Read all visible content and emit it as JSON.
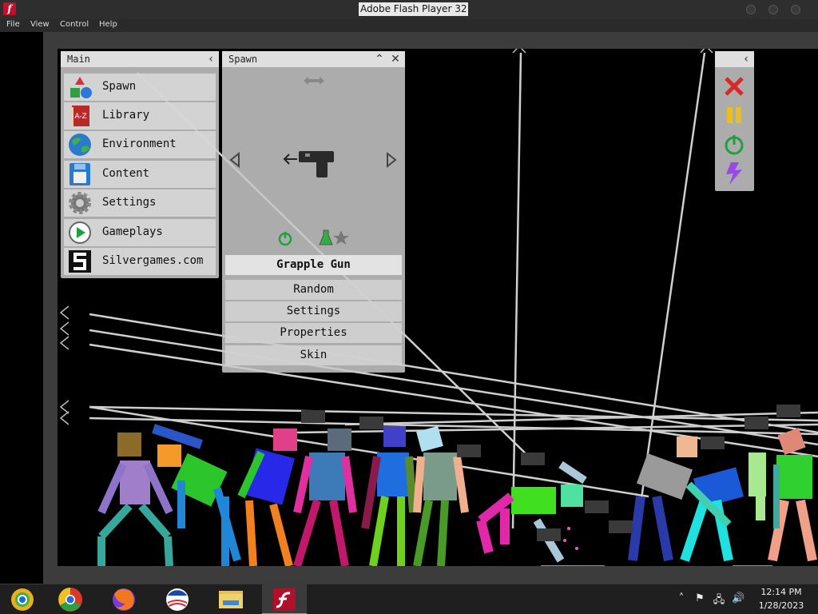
{
  "window": {
    "title": "Adobe Flash Player 32",
    "menu": [
      "File",
      "View",
      "Control",
      "Help"
    ]
  },
  "main_panel": {
    "title": "Main",
    "items": [
      {
        "label": "Spawn",
        "icon": "shapes-icon"
      },
      {
        "label": "Library",
        "icon": "book-icon"
      },
      {
        "label": "Environment",
        "icon": "globe-icon"
      },
      {
        "label": "Content",
        "icon": "floppy-disk-icon"
      },
      {
        "label": "Settings",
        "icon": "gear-icon"
      },
      {
        "label": "Gameplays",
        "icon": "play-icon"
      },
      {
        "label": "Silvergames.com",
        "icon": "silvergames-logo-icon"
      }
    ]
  },
  "spawn_panel": {
    "title": "Spawn",
    "selected_item": "Grapple Gun",
    "buttons": [
      "Random",
      "Settings",
      "Properties",
      "Skin"
    ]
  },
  "tools_panel": {
    "tools": [
      {
        "name": "delete-tool",
        "icon": "red-x-icon"
      },
      {
        "name": "pause-tool",
        "icon": "pause-icon"
      },
      {
        "name": "power-tool",
        "icon": "power-icon"
      },
      {
        "name": "lightning-tool",
        "icon": "lightning-icon"
      }
    ]
  },
  "taskbar": {
    "apps": [
      "Chrome Canary",
      "Google Chrome",
      "Firefox",
      "Obama campaign",
      "File Explorer",
      "Flash Player"
    ],
    "time": "12:14 PM",
    "date": "1/28/2023"
  },
  "colors": {
    "stage_bg": "#000000",
    "panel_bg": "#c8c8c8",
    "taskbar_bg": "#1f1f1f"
  }
}
